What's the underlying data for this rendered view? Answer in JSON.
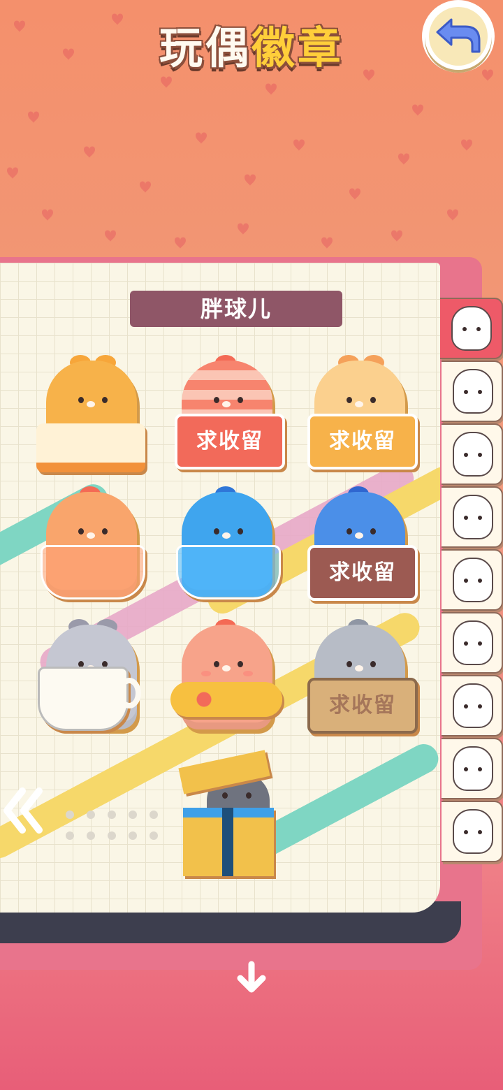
{
  "header": {
    "title_part1": "玩偶",
    "title_part2": "徽章",
    "back_icon": "return-arrow-icon"
  },
  "page": {
    "title": "胖球儿",
    "badges": [
      {
        "name": "cake",
        "color": "#f7a63a",
        "sign": ""
      },
      {
        "name": "striped-hat",
        "color": "#f46a55",
        "sign": "求收留"
      },
      {
        "name": "hamster-box",
        "color": "#f7b24a",
        "sign": "求收留"
      },
      {
        "name": "orange-jar",
        "color": "#f99a5c",
        "sign": ""
      },
      {
        "name": "blue-jar",
        "color": "#3fa5ee",
        "sign": ""
      },
      {
        "name": "blue-box",
        "color": "#4b8fe8",
        "sign": "求收留"
      },
      {
        "name": "gray-cup",
        "color": "#b9b9c6",
        "sign": ""
      },
      {
        "name": "swim-ring",
        "color": "#f58a6c",
        "sign": ""
      },
      {
        "name": "gray-cardboard",
        "color": "#a9aeb8",
        "sign": "求收留"
      },
      {
        "name": "gift-box",
        "color": "#f2c14b",
        "sign": ""
      }
    ],
    "prev_icon": "double-chevron-left-icon"
  },
  "tabs": [
    {
      "name": "chubby-ball",
      "active": true
    },
    {
      "name": "bear",
      "active": false
    },
    {
      "name": "tomato",
      "active": false
    },
    {
      "name": "fox",
      "active": false
    },
    {
      "name": "bunny-girl",
      "active": false
    },
    {
      "name": "prince",
      "active": false
    },
    {
      "name": "warrior",
      "active": false
    },
    {
      "name": "curly",
      "active": false
    },
    {
      "name": "rabbit",
      "active": false
    }
  ],
  "footer": {
    "down_icon": "down-arrow-icon"
  }
}
